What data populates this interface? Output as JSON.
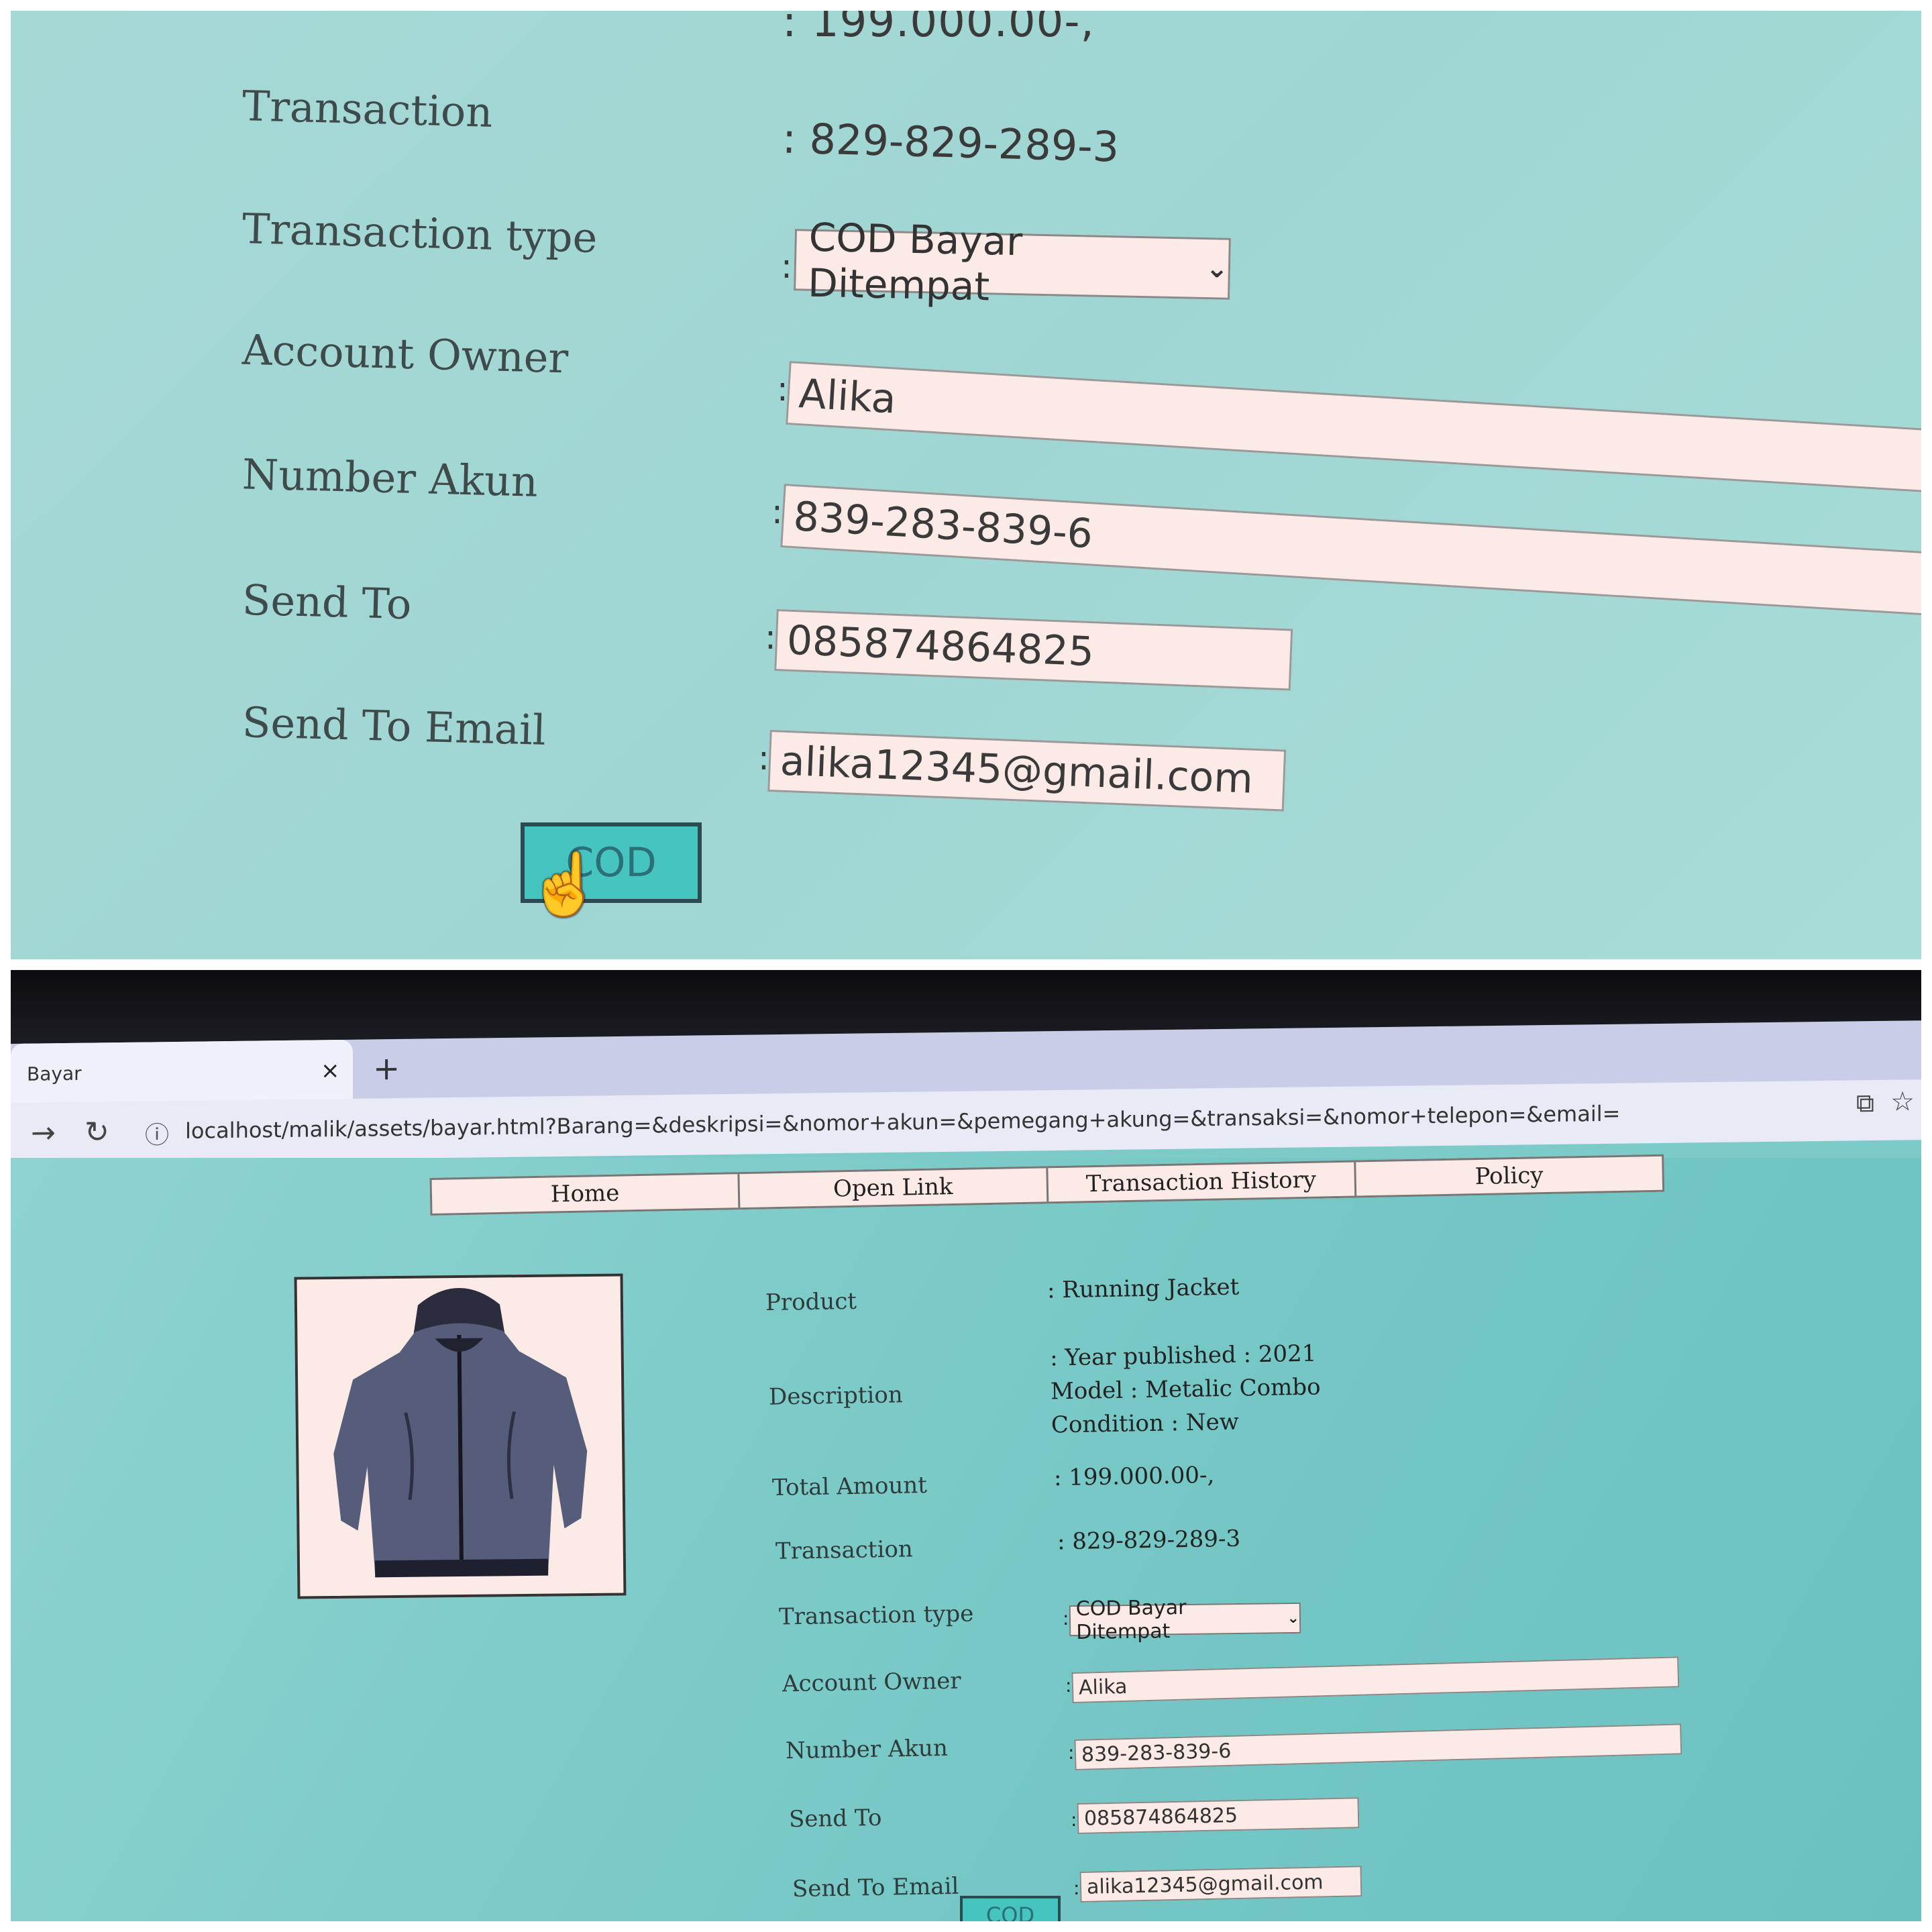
{
  "zoom_view": {
    "total_amount_partial": ": 199.000.00-,",
    "fields": {
      "transaction": {
        "label": "Transaction",
        "value": ": 829-829-289-3"
      },
      "transaction_type": {
        "label": "Transaction type",
        "selected": "COD Bayar Ditempat"
      },
      "account_owner": {
        "label": "Account Owner",
        "value": "Alika"
      },
      "number_akun": {
        "label": "Number Akun",
        "value": "839-283-839-6"
      },
      "send_to": {
        "label": "Send To",
        "value": "085874864825"
      },
      "send_to_email": {
        "label": "Send To Email",
        "value": "alika12345@gmail.com"
      }
    },
    "colon": ":",
    "submit_label": "COD"
  },
  "browser": {
    "tab_title": "Bayar",
    "tab_close": "×",
    "new_tab": "+",
    "url": "localhost/malik/assets/bayar.html?Barang=&deskripsi=&nomor+akun=&pemegang+akung=&transaksi=&nomor+telepon=&email="
  },
  "nav": {
    "items": [
      "Home",
      "Open Link",
      "Transaction History",
      "Policy"
    ]
  },
  "product": {
    "image_icon": "jacket-image",
    "label": "Product",
    "value": ": Running Jacket"
  },
  "description": {
    "label": "Description",
    "line1": ": Year published : 2021",
    "line2": "Model : Metalic Combo",
    "line3": "Condition : New"
  },
  "total_amount": {
    "label": "Total Amount",
    "value": ": 199.000.00-,"
  },
  "form": {
    "colon": ":",
    "transaction": {
      "label": "Transaction",
      "value": ": 829-829-289-3"
    },
    "transaction_type": {
      "label": "Transaction type",
      "selected": "COD Bayar Ditempat"
    },
    "account_owner": {
      "label": "Account Owner",
      "value": "Alika"
    },
    "number_akun": {
      "label": "Number Akun",
      "value": "839-283-839-6"
    },
    "send_to": {
      "label": "Send To",
      "value": "085874864825"
    },
    "send_to_email": {
      "label": "Send To Email",
      "value": "alika12345@gmail.com"
    },
    "submit_label": "COD"
  },
  "colors": {
    "page_bg": "#7ccbc9",
    "field_bg": "#fbeae6",
    "button_bg": "#46c4c0",
    "button_border": "#2d4a53"
  }
}
